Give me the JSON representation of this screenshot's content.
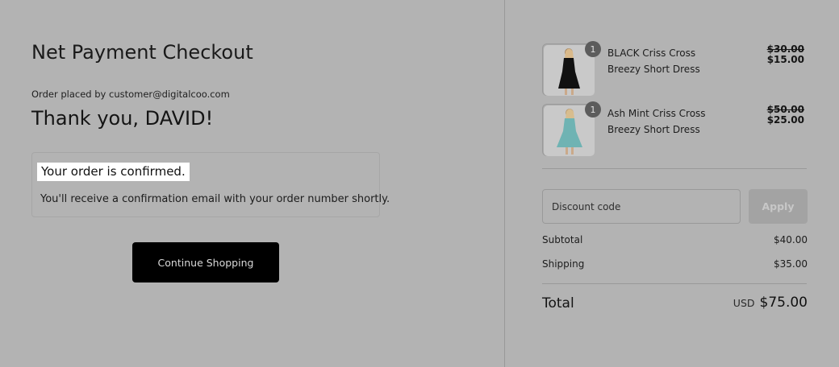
{
  "checkout": {
    "store_name": "Net Payment Checkout",
    "order_placed_by": "Order placed by customer@digitalcoo.com",
    "thank_you": "Thank you, DAVID!",
    "confirmation": {
      "title": "Your order is confirmed.",
      "message": "You'll receive a confirmation email with your order number shortly."
    },
    "continue_label": "Continue Shopping"
  },
  "summary": {
    "items": [
      {
        "name": "BLACK Criss Cross Breezy Short Dress",
        "quantity": "1",
        "original_price": "$30.00",
        "price": "$15.00",
        "dress_color": "#111111"
      },
      {
        "name": "Ash Mint Criss Cross Breezy Short Dress",
        "quantity": "1",
        "original_price": "$50.00",
        "price": "$25.00",
        "dress_color": "#6fb3b3"
      }
    ],
    "discount": {
      "placeholder": "Discount code",
      "apply_label": "Apply"
    },
    "subtotal_label": "Subtotal",
    "subtotal_value": "$40.00",
    "shipping_label": "Shipping",
    "shipping_value": "$35.00",
    "total_label": "Total",
    "currency": "USD",
    "total_value": "$75.00"
  },
  "colors": {
    "overlay_background": "#b3b3b3",
    "button_dark": "#000000"
  }
}
